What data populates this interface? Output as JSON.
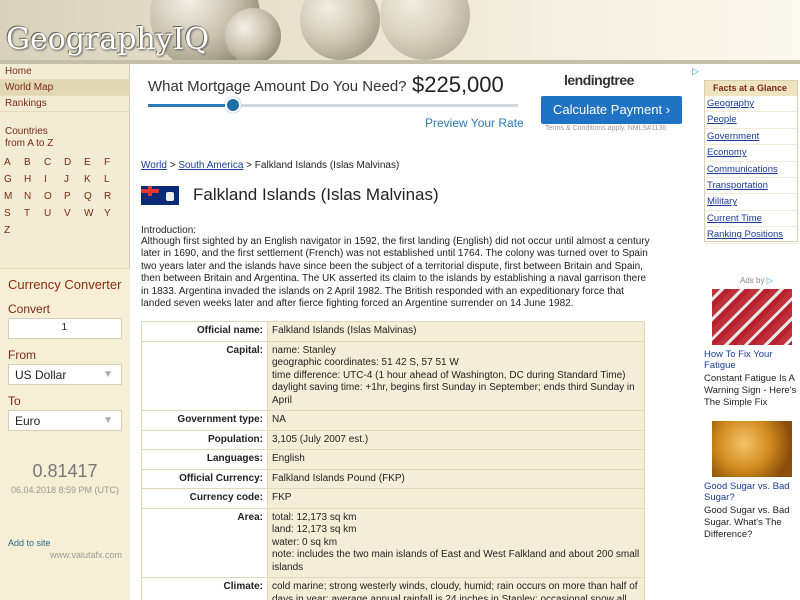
{
  "header": {
    "logo": "GeographyIQ"
  },
  "nav": [
    {
      "label": "Home"
    },
    {
      "label": "World Map"
    },
    {
      "label": "Rankings"
    }
  ],
  "countries": {
    "title_line1": "Countries",
    "title_line2": "from A to Z",
    "letters": [
      "A",
      "B",
      "C",
      "D",
      "E",
      "F",
      "G",
      "H",
      "I",
      "J",
      "K",
      "L",
      "M",
      "N",
      "O",
      "P",
      "Q",
      "R",
      "S",
      "T",
      "U",
      "V",
      "W",
      "Y",
      "Z"
    ]
  },
  "currency": {
    "title": "Currency Converter",
    "convert_label": "Convert",
    "amount": "1",
    "from_label": "From",
    "from_value": "US Dollar",
    "to_label": "To",
    "to_value": "Euro",
    "rate": "0.81417",
    "rate_date": "06.04.2018 8:59 PM (UTC)",
    "add_to_site": "Add to site",
    "provider": "www.valutafx.com"
  },
  "ad_top": {
    "question": "What Mortgage Amount Do You Need?",
    "amount": "$225,000",
    "slider_value_pct": 23,
    "preview": "Preview Your Rate",
    "brand": "lendingtree",
    "button": "Calculate Payment ›",
    "terms": "Terms & Conditions apply. NMLS#1136"
  },
  "facts": {
    "title": "Facts at a Glance",
    "links": [
      "Geography",
      "People",
      "Government",
      "Economy",
      "Communications",
      "Transportation",
      "Military",
      "Current Time",
      "Ranking Positions"
    ]
  },
  "right_ads": {
    "ads_by": "Ads by",
    "items": [
      {
        "headline": "How To Fix Your Fatigue",
        "text": "Constant Fatigue Is A Warning Sign - Here's The Simple Fix"
      },
      {
        "headline": "Good Sugar vs. Bad Sugar?",
        "text": "Good Sugar vs. Bad Sugar. What's The Difference?"
      }
    ]
  },
  "breadcrumb": {
    "world": "World",
    "sep1": " > ",
    "region": "South America",
    "sep2": " > ",
    "current": "Falkland Islands (Islas Malvinas)"
  },
  "country_title": "Falkland Islands (Islas Malvinas)",
  "intro": {
    "label": "Introduction:",
    "text": "Although first sighted by an English navigator in 1592, the first landing (English) did not occur until almost a century later in 1690, and the first settlement (French) was not established until 1764. The colony was turned over to Spain two years later and the islands have since been the subject of a territorial dispute, first between Britain and Spain, then between Britain and Argentina. The UK asserted its claim to the islands by establishing a naval garrison there in 1833. Argentina invaded the islands on 2 April 1982. The British responded with an expeditionary force that landed seven weeks later and after fierce fighting forced an Argentine surrender on 14 June 1982."
  },
  "facts_table": [
    {
      "key": "Official name:",
      "lines": [
        "Falkland Islands (Islas Malvinas)"
      ]
    },
    {
      "key": "Capital:",
      "lines": [
        "name: Stanley",
        "geographic coordinates: 51 42 S, 57 51 W",
        "time difference: UTC-4 (1 hour ahead of Washington, DC during Standard Time)",
        "daylight saving time: +1hr, begins first Sunday in September; ends third Sunday in April"
      ]
    },
    {
      "key": "Government type:",
      "lines": [
        "NA"
      ]
    },
    {
      "key": "Population:",
      "lines": [
        "3,105 (July 2007 est.)"
      ]
    },
    {
      "key": "Languages:",
      "lines": [
        "English"
      ]
    },
    {
      "key": "Official Currency:",
      "lines": [
        "Falkland Islands Pound (FKP)"
      ]
    },
    {
      "key": "Currency code:",
      "lines": [
        "FKP"
      ]
    },
    {
      "key": "Area:",
      "lines": [
        "total: 12,173 sq km",
        "land: 12,173 sq km",
        "water: 0 sq km",
        "note: includes the two main islands of East and West Falkland and about 200 small islands"
      ]
    },
    {
      "key": "Climate:",
      "lines": [
        "cold marine; strong westerly winds, cloudy, humid; rain occurs on more than half of days in year; average annual rainfall is 24 inches in Stanley; occasional snow all year, except in January and February, but does not accumulate"
      ]
    }
  ]
}
